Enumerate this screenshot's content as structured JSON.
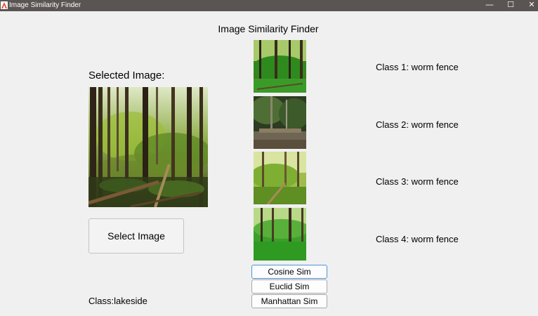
{
  "window": {
    "title": "Image Similarity Finder",
    "controls": {
      "minimize": "—",
      "maximize": "☐",
      "close": "✕"
    }
  },
  "app": {
    "title": "Image Similarity Finder",
    "selected_label": "Selected Image:",
    "select_button": "Select Image",
    "class_result": "Class:lakeside"
  },
  "results": [
    {
      "label": "Class 1: worm fence"
    },
    {
      "label": "Class 2: worm fence"
    },
    {
      "label": "Class 3: worm fence"
    },
    {
      "label": "Class 4: worm fence"
    }
  ],
  "buttons": {
    "cosine": "Cosine Sim",
    "euclid": "Euclid Sim",
    "manhattan": "Manhattan Sim"
  },
  "colors": {
    "titlebar": "#5a5452",
    "background": "#f0f0f0",
    "focus_border": "#4f95d6"
  }
}
